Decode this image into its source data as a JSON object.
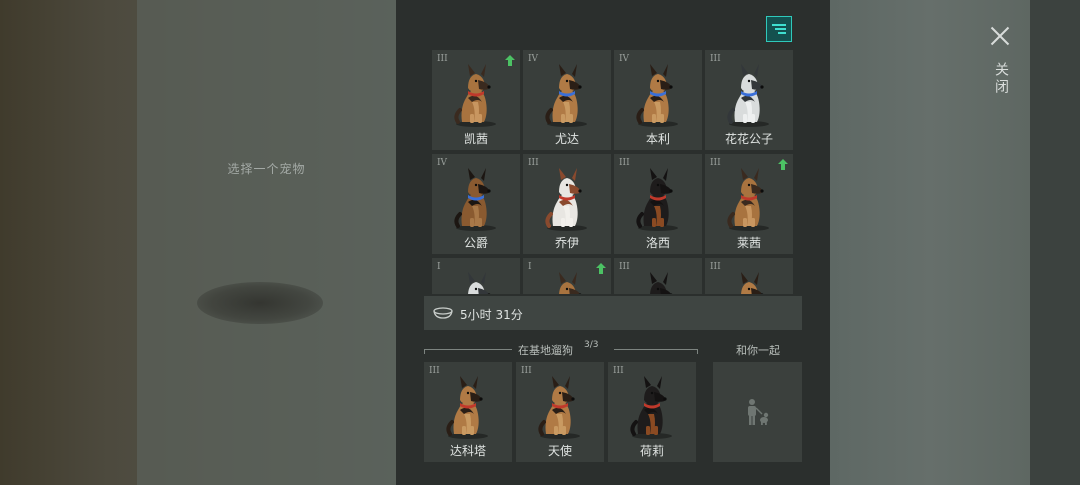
{
  "left_panel": {
    "prompt": "选择一个宠物"
  },
  "close": {
    "label": "关闭",
    "icon": "close-icon"
  },
  "filter": {
    "icon": "filter-icon",
    "accent": "#2fc9bb"
  },
  "pets": [
    {
      "tier": "III",
      "name": "凯茜",
      "upgrade": true,
      "breed": "shepherd-pup",
      "collar": "#c0392b"
    },
    {
      "tier": "IV",
      "name": "尤达",
      "upgrade": false,
      "breed": "shepherd",
      "collar": "#3a6fd8"
    },
    {
      "tier": "IV",
      "name": "本利",
      "upgrade": false,
      "breed": "shepherd",
      "collar": "#3a6fd8"
    },
    {
      "tier": "III",
      "name": "花花公子",
      "upgrade": false,
      "breed": "husky",
      "collar": "#3a6fd8"
    },
    {
      "tier": "IV",
      "name": "公爵",
      "upgrade": false,
      "breed": "shepherd-dark",
      "collar": "#3a6fd8"
    },
    {
      "tier": "III",
      "name": "乔伊",
      "upgrade": false,
      "breed": "husky-red",
      "collar": "#c0392b"
    },
    {
      "tier": "III",
      "name": "洛西",
      "upgrade": false,
      "breed": "rottweiler",
      "collar": "#c0392b"
    },
    {
      "tier": "III",
      "name": "莱茜",
      "upgrade": true,
      "breed": "shepherd-pup",
      "collar": "#c0392b"
    },
    {
      "tier": "I",
      "name": "",
      "upgrade": false,
      "breed": "husky",
      "collar": "#3a6fd8"
    },
    {
      "tier": "I",
      "name": "",
      "upgrade": true,
      "breed": "shepherd-pup",
      "collar": "#c0392b"
    },
    {
      "tier": "III",
      "name": "",
      "upgrade": false,
      "breed": "rottweiler",
      "collar": "#c0392b"
    },
    {
      "tier": "III",
      "name": "",
      "upgrade": false,
      "breed": "shepherd",
      "collar": "#c0392b"
    }
  ],
  "timer": {
    "icon": "bowl-icon",
    "text": "5小时 31分"
  },
  "base_section": {
    "title": "在基地遛狗",
    "count": "3/3"
  },
  "base_pets": [
    {
      "tier": "III",
      "name": "达科塔",
      "breed": "shepherd",
      "collar": "#c0392b"
    },
    {
      "tier": "III",
      "name": "天使",
      "breed": "shepherd",
      "collar": "#c0392b"
    },
    {
      "tier": "III",
      "name": "荷莉",
      "breed": "rottweiler",
      "collar": "#c0392b"
    }
  ],
  "with_you": {
    "title": "和你一起",
    "icon": "person-with-dog-icon"
  },
  "colors": {
    "upgrade": "#4cc264",
    "panel": "#2b2f2d",
    "tile": "#393e3b"
  }
}
